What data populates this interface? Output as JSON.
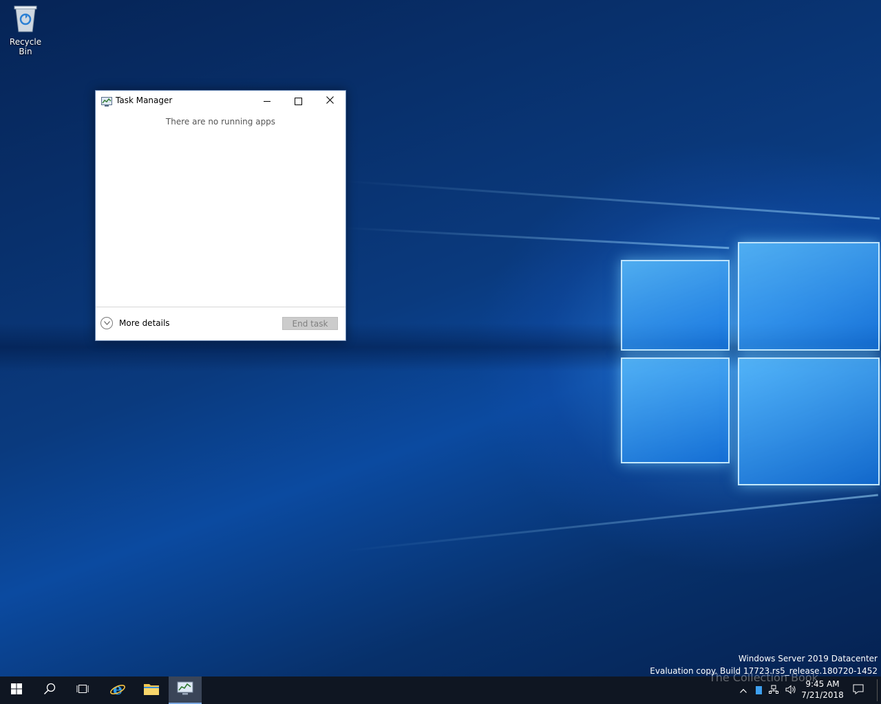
{
  "desktop": {
    "icons": [
      {
        "label": "Recycle Bin",
        "icon": "recycle-bin-icon"
      }
    ]
  },
  "task_manager": {
    "title": "Task Manager",
    "empty_message": "There are no running apps",
    "more_details_label": "More details",
    "end_task_label": "End task",
    "controls": {
      "minimize": "minimize-icon",
      "maximize": "maximize-icon",
      "close": "close-icon"
    }
  },
  "edition": {
    "line1": "Windows Server 2019 Datacenter",
    "line2": "Evaluation copy. Build 17723.rs5_release.180720-1452"
  },
  "taskbar": {
    "buttons": [
      {
        "name": "start",
        "icon": "windows-logo-icon"
      },
      {
        "name": "search",
        "icon": "search-icon"
      },
      {
        "name": "task-view",
        "icon": "task-view-icon"
      },
      {
        "name": "internet-explorer",
        "icon": "internet-explorer-icon"
      },
      {
        "name": "file-explorer",
        "icon": "folder-icon"
      },
      {
        "name": "task-manager",
        "icon": "task-manager-icon",
        "active": true
      }
    ],
    "tray": {
      "icons": [
        "chevron-up-icon",
        "network-icon",
        "volume-icon"
      ],
      "time": "9:45 AM",
      "date": "7/21/2018",
      "notification_icon": "notification-icon"
    }
  },
  "watermark": "The Collection Book",
  "colors": {
    "accent": "#0078d7",
    "taskbar": "#0f1622",
    "window_border": "#6b8bb8"
  }
}
